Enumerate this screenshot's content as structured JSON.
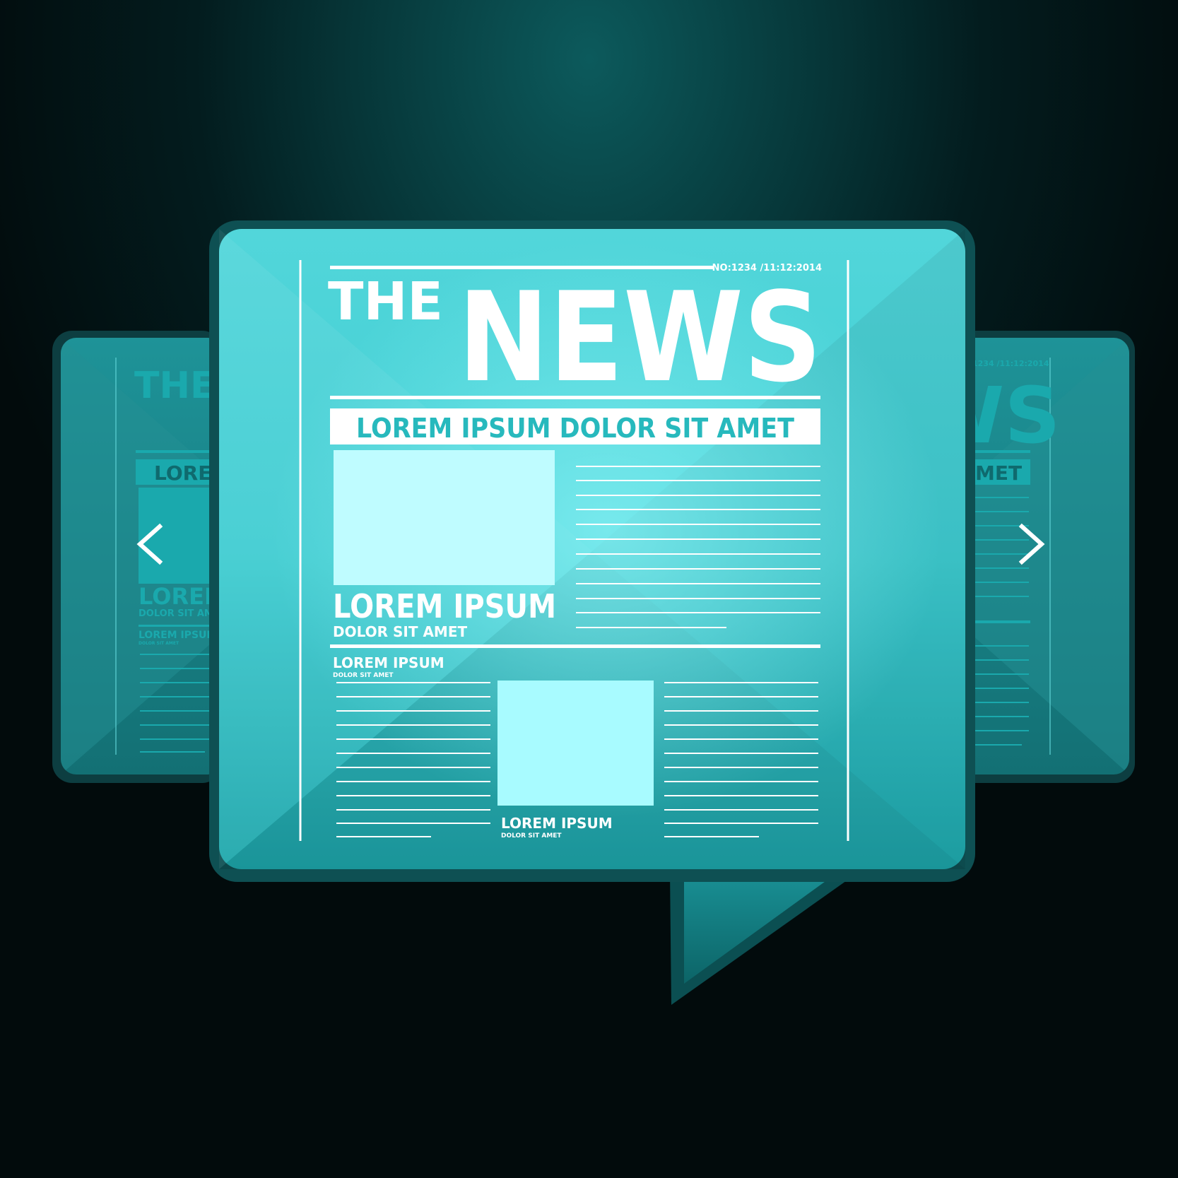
{
  "colors": {
    "accent": "#1fc0c4",
    "panel_light": "#55dbdf",
    "panel_dark": "#1a9ea3",
    "back_panel": "#1a7f83",
    "image_placeholder": "#bffcff",
    "text_white": "#ffffff",
    "background": "#031c1e"
  },
  "icons": {
    "prev": "chevron-left-icon",
    "next": "chevron-right-icon"
  },
  "front": {
    "masthead_small": "THE",
    "masthead_large": "NEWS",
    "issue_info": "NO:1234 /11:12:2014",
    "banner": "LOREM IPSUM DOLOR SIT AMET",
    "lead_title": "LOREM IPSUM",
    "lead_subtitle": "DOLOR SIT AMET",
    "second_title": "LOREM IPSUM",
    "second_subtitle": "DOLOR SIT AMET",
    "third_title": "LOREM IPSUM",
    "third_subtitle": "DOLOR SIT AMET"
  },
  "back_left": {
    "masthead_small": "THE",
    "banner_fragment": "LOREM",
    "title": "LOREM",
    "subtitle": "DOLOR SIT AME",
    "small_title": "LOREM IPSUM",
    "small_subtitle": "DOLOR SIT AMET"
  },
  "back_right": {
    "issue_fragment": "1234 /11:12:2014",
    "masthead_fragment": "WS",
    "banner_fragment": "MET"
  }
}
